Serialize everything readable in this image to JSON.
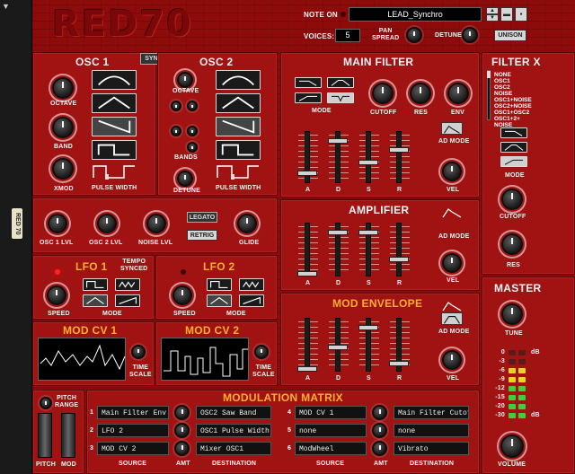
{
  "rack": {
    "tag": "RED 70"
  },
  "header": {
    "logo": "RED70",
    "note_on": "NOTE ON",
    "patch_name": "LEAD_Synchro",
    "voices_label": "VOICES:",
    "voices_value": "5",
    "pan_spread": "PAN\nSPREAD",
    "detune": "DETUNE",
    "unison": "UNISON"
  },
  "osc1": {
    "title": "OSC 1",
    "octave": "OCTAVE",
    "band": "BAND",
    "xmod": "XMOD",
    "pulse_width": "PULSE WIDTH"
  },
  "sync": "SYNC",
  "osc2": {
    "title": "OSC 2",
    "octave": "OCTAVE",
    "bands": "BANDS",
    "detune": "DETUNE",
    "pulse_width": "PULSE WIDTH"
  },
  "mixer": {
    "osc1": "OSC 1 LVL",
    "osc2": "OSC 2 LVL",
    "noise": "NOISE LVL",
    "legato": "LEGATO",
    "retrig": "RETRIG",
    "glide": "GLIDE"
  },
  "lfo1": {
    "title": "LFO 1",
    "tempo": "TEMPO\nSYNCED",
    "speed": "SPEED",
    "mode": "MODE"
  },
  "lfo2": {
    "title": "LFO 2",
    "speed": "SPEED",
    "mode": "MODE"
  },
  "modcv1": {
    "title": "MOD CV 1",
    "time_scale": "TIME\nSCALE"
  },
  "modcv2": {
    "title": "MOD CV 2",
    "time_scale": "TIME\nSCALE"
  },
  "main_filter": {
    "title": "MAIN FILTER",
    "mode": "MODE",
    "cutoff": "CUTOFF",
    "res": "RES",
    "env": "ENV",
    "ad_mode": "AD MODE",
    "vel": "VEL",
    "a": "A",
    "d": "D",
    "s": "S",
    "r": "R"
  },
  "amplifier": {
    "title": "AMPLIFIER",
    "ad_mode": "AD MODE",
    "vel": "VEL",
    "a": "A",
    "d": "D",
    "s": "S",
    "r": "R"
  },
  "mod_envelope": {
    "title": "MOD ENVELOPE",
    "ad_mode": "AD MODE",
    "vel": "VEL",
    "a": "A",
    "d": "D",
    "s": "S",
    "r": "R"
  },
  "filter_x": {
    "title": "FILTER X",
    "options": [
      "NONE",
      "OSC1",
      "OSC2",
      "NOISE",
      "OSC1+NOISE",
      "OSC2+NOISE",
      "OSC1+OSC2",
      "OSC1+2+",
      "NOISE"
    ],
    "mode": "MODE",
    "cutoff": "CUTOFF",
    "res": "RES"
  },
  "master": {
    "title": "MASTER",
    "tune": "TUNE",
    "volume": "VOLUME",
    "db_labels": [
      "0",
      "-3",
      "-6",
      "-9",
      "-12",
      "-15",
      "-20",
      "-30"
    ],
    "db_unit": "dB"
  },
  "pitch": {
    "range": "PITCH\nRANGE",
    "pitch": "PITCH",
    "mod": "MOD"
  },
  "mod_matrix": {
    "title": "MODULATION MATRIX",
    "source_label": "SOURCE",
    "amt_label": "AMT",
    "dest_label": "DESTINATION",
    "rows": [
      {
        "n": "1",
        "source": "Main Filter Env",
        "dest": "OSC2 Saw Band"
      },
      {
        "n": "2",
        "source": "LFO 2",
        "dest": "OSC1 Pulse Width"
      },
      {
        "n": "3",
        "source": "MOD CV 2",
        "dest": "Mixer OSC1"
      },
      {
        "n": "4",
        "source": "MOD CV 1",
        "dest": "Main Filter Cutof"
      },
      {
        "n": "5",
        "source": "none",
        "dest": "none"
      },
      {
        "n": "6",
        "source": "ModWheel",
        "dest": "Vibrato"
      }
    ]
  },
  "colors": {
    "device": "#8e0b0b",
    "panel": "#a11313",
    "accent": "#ffb02e",
    "led_green": "#3ad13a",
    "led_yellow": "#e8d520",
    "led_red": "#ff2020"
  }
}
